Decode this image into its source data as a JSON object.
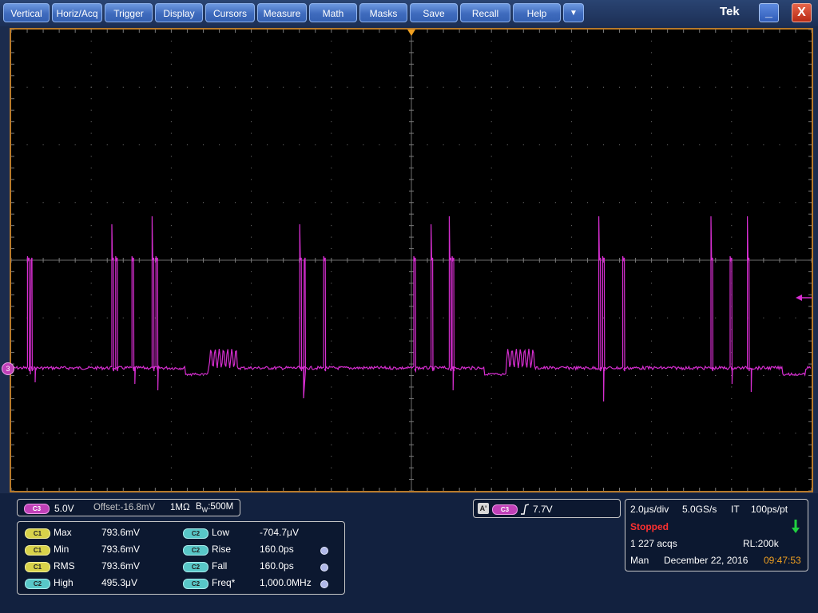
{
  "menu": [
    "Vertical",
    "Horiz/Acq",
    "Trigger",
    "Display",
    "Cursors",
    "Measure",
    "Math",
    "Masks",
    "Save",
    "Recall",
    "Help"
  ],
  "menu_more": "▼",
  "brand": "Tek",
  "window": {
    "minimize": "_",
    "close": "X"
  },
  "channel_marker": "3",
  "colors": {
    "trace": "#d62ed0",
    "graticule": "#7a7a7a",
    "frame": "#b87a2a",
    "trigger": "#f0a020"
  },
  "channel": {
    "badge": "C3",
    "scale": "5.0V",
    "offset": "Offset:-16.8mV",
    "impedance": "1MΩ",
    "bw_prefix": "B",
    "bw_sub": "W",
    "bandwidth": ":500M"
  },
  "trigger_info": {
    "badge_a": "A'",
    "badge_ch": "C3",
    "level": "7.7V"
  },
  "measurements": [
    {
      "badge": "C1",
      "name": "Max",
      "value": "793.6mV"
    },
    {
      "badge": "C1",
      "name": "Min",
      "value": "793.6mV"
    },
    {
      "badge": "C1",
      "name": "RMS",
      "value": "793.6mV"
    },
    {
      "badge": "C2",
      "name": "High",
      "value": "495.3μV"
    },
    {
      "badge": "C2",
      "name": "Low",
      "value": "-704.7μV"
    },
    {
      "badge": "C2",
      "name": "Rise",
      "value": "160.0ps"
    },
    {
      "badge": "C2",
      "name": "Fall",
      "value": "160.0ps"
    },
    {
      "badge": "C2",
      "name": "Freq*",
      "value": "1,000.0MHz"
    }
  ],
  "acq": {
    "timebase": "2.0μs/div",
    "sample_rate": "5.0GS/s",
    "mode": "IT",
    "resolution": "100ps/pt",
    "state": "Stopped",
    "acqs": "1 227 acqs",
    "record_length": "RL:200k",
    "trigger_mode": "Man",
    "date": "December 22, 2016",
    "time": "09:47:53"
  }
}
